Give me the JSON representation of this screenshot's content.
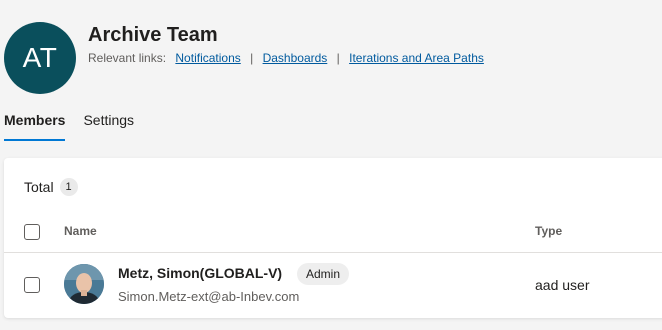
{
  "team": {
    "initials": "AT",
    "name": "Archive Team",
    "relevant_links_label": "Relevant links:",
    "links": [
      "Notifications",
      "Dashboards",
      "Iterations and Area Paths"
    ],
    "avatar_color": "#0a4f5c"
  },
  "tabs": [
    {
      "label": "Members",
      "active": true
    },
    {
      "label": "Settings",
      "active": false
    }
  ],
  "members_table": {
    "total_label": "Total",
    "total_count": "1",
    "columns": {
      "name": "Name",
      "type": "Type"
    },
    "rows": [
      {
        "name": "Metz, Simon(GLOBAL-V)",
        "role": "Admin",
        "email": "Simon.Metz-ext@ab-Inbev.com",
        "type": "aad user"
      }
    ]
  },
  "colors": {
    "accent": "#0078d4",
    "link": "#005a9e"
  }
}
